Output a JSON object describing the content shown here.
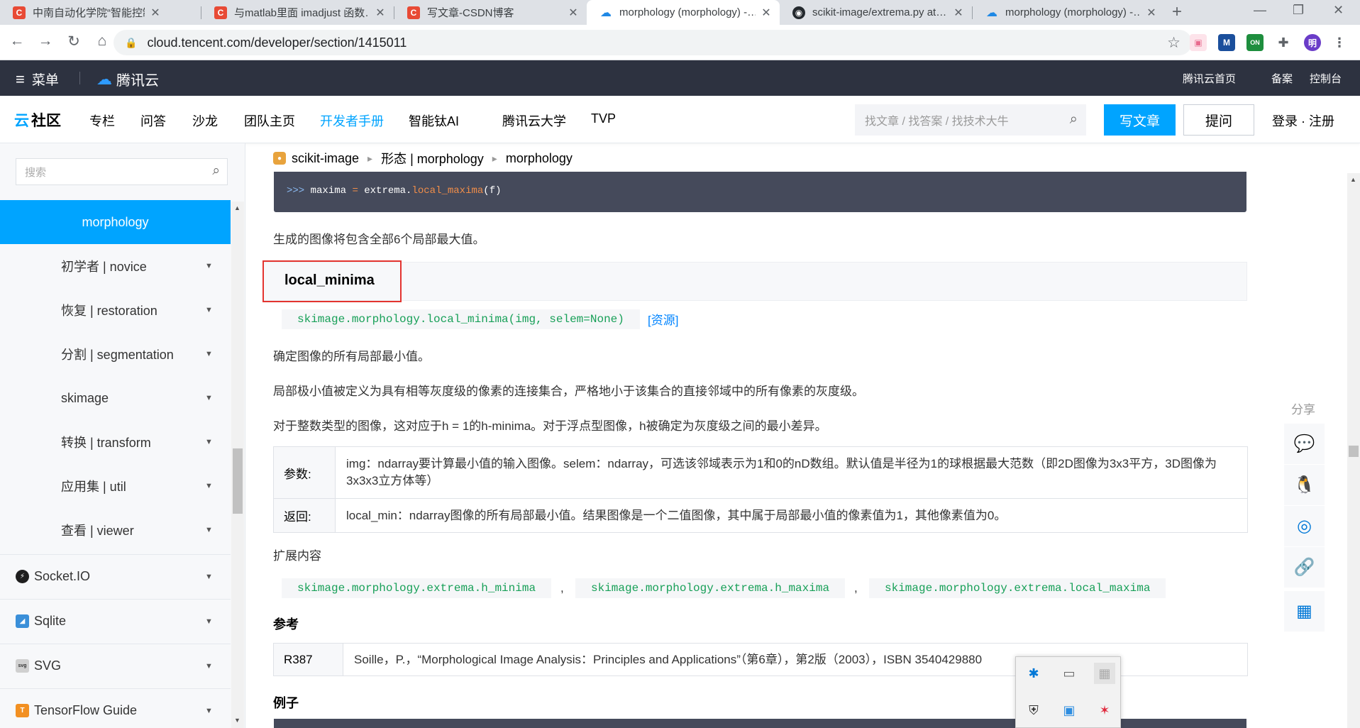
{
  "browser": {
    "tabs": [
      {
        "title": "中南自动化学院“智能控制与…",
        "favicon": "csdn"
      },
      {
        "title": "与matlab里面 imadjust 函数…",
        "favicon": "csdn"
      },
      {
        "title": "写文章-CSDN博客",
        "favicon": "csdn"
      },
      {
        "title": "morphology (morphology) -…",
        "favicon": "cloud",
        "active": true
      },
      {
        "title": "scikit-image/extrema.py at…",
        "favicon": "github"
      },
      {
        "title": "morphology (morphology) -…",
        "favicon": "cloud"
      }
    ],
    "url": "cloud.tencent.com/developer/section/1415011",
    "extensions": [
      "M",
      "ON",
      "明"
    ]
  },
  "header": {
    "menu_label": "菜单",
    "brand": "腾讯云",
    "links": [
      "腾讯云首页",
      "备案",
      "控制台"
    ]
  },
  "subnav": {
    "logo_prefix": "云",
    "logo": "社区",
    "items": [
      "专栏",
      "问答",
      "沙龙",
      "团队主页",
      "开发者手册",
      "智能钛AI",
      "腾讯云大学",
      "TVP"
    ],
    "active_item": "开发者手册",
    "search_placeholder": "找文章 / 找答案 / 找技术大牛",
    "write_label": "写文章",
    "ask_label": "提问",
    "login_label": "登录 · 注册"
  },
  "sidebar": {
    "search_placeholder": "搜索",
    "active": "morphology",
    "items": [
      "初学者 | novice",
      "恢复 | restoration",
      "分割 | segmentation",
      "skimage",
      "转换 | transform",
      "应用集 | util",
      "查看 | viewer"
    ],
    "groups": [
      {
        "label": "Socket.IO",
        "icon": "socketio-icon",
        "color": "#1e1e1e"
      },
      {
        "label": "Sqlite",
        "icon": "sqlite-icon",
        "color": "#3a8fd9"
      },
      {
        "label": "SVG",
        "icon": "svg-icon",
        "color": "#d0d0d0"
      },
      {
        "label": "TensorFlow Guide",
        "icon": "tensorflow-icon",
        "color": "#f29022"
      }
    ]
  },
  "breadcrumb": [
    "scikit-image",
    "形态 | morphology",
    "morphology"
  ],
  "content": {
    "code_prompt": ">>>",
    "code_line_pre": "maxima ",
    "code_line_eq": "=",
    "code_line_mid": " extrema.",
    "code_line_fn": "local_maxima",
    "code_line_post": "(f)",
    "para_maxima": "生成的图像将包含全部6个局部最大值。",
    "section_title": "local_minima",
    "signature": "skimage.morphology.local_minima(img, selem=None)",
    "source_link": "[资源]",
    "desc1": "确定图像的所有局部最小值。",
    "desc2": "局部极小值被定义为具有相等灰度级的像素的连接集合，严格地小于该集合的直接邻域中的所有像素的灰度级。",
    "desc3": "对于整数类型的图像，这对应于h = 1的h-minima。对于浮点型图像，h被确定为灰度级之间的最小差异。",
    "params_label": "参数:",
    "params_value": "img：ndarray要计算最小值的输入图像。selem：ndarray，可选该邻域表示为1和0的nD数组。默认值是半径为1的球根据最大范数（即2D图像为3x3平方，3D图像为3x3x3立方体等）",
    "returns_label": "返回:",
    "returns_value": "local_min：ndarray图像的所有局部最小值。结果图像是一个二值图像，其中属于局部最小值的像素值为1，其他像素值为0。",
    "extended_heading": "扩展内容",
    "see_also": [
      "skimage.morphology.extrema.h_minima",
      "skimage.morphology.extrema.h_maxima",
      "skimage.morphology.extrema.local_maxima"
    ],
    "see_also_sep": ",",
    "ref_heading": "参考",
    "ref_key": "R387",
    "ref_value": "Soille，P.，“Morphological Image Analysis：Principles and Applications”（第6章），第2版（2003），ISBN 3540429880",
    "example_heading": "例子"
  },
  "share": {
    "label": "分享",
    "icons": [
      "wechat-icon",
      "qq-icon",
      "weibo-icon",
      "link-icon",
      "qrcode-icon"
    ]
  },
  "colors": {
    "accent": "#00a4ff",
    "header_bg": "#2d3240",
    "code_bg": "#454a5b",
    "code_green": "#18a058",
    "highlight_red": "#e3342f"
  }
}
